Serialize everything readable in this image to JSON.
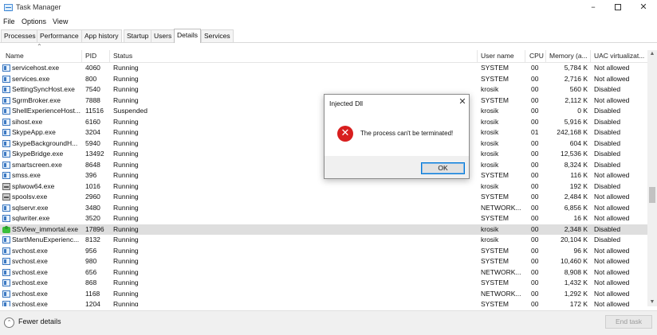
{
  "window": {
    "title": "Task Manager"
  },
  "menu": [
    "File",
    "Options",
    "View"
  ],
  "tabs": [
    {
      "label": "Processes",
      "active": false
    },
    {
      "label": "Performance",
      "active": false
    },
    {
      "label": "App history",
      "active": false
    },
    {
      "label": "Startup",
      "active": false
    },
    {
      "label": "Users",
      "active": false
    },
    {
      "label": "Details",
      "active": true
    },
    {
      "label": "Services",
      "active": false
    }
  ],
  "columns": {
    "name": "Name",
    "pid": "PID",
    "status": "Status",
    "user": "User name",
    "cpu": "CPU",
    "memory": "Memory (a...",
    "uac": "UAC virtualizat..."
  },
  "rows": [
    {
      "name": "servicehost.exe",
      "pid": "4060",
      "status": "Running",
      "user": "SYSTEM",
      "cpu": "00",
      "mem": "5,784 K",
      "uac": "Not allowed",
      "icon": "process-icon"
    },
    {
      "name": "services.exe",
      "pid": "800",
      "status": "Running",
      "user": "SYSTEM",
      "cpu": "00",
      "mem": "2,716 K",
      "uac": "Not allowed",
      "icon": "process-icon"
    },
    {
      "name": "SettingSyncHost.exe",
      "pid": "7540",
      "status": "Running",
      "user": "krosik",
      "cpu": "00",
      "mem": "560 K",
      "uac": "Disabled",
      "icon": "process-icon"
    },
    {
      "name": "SgrmBroker.exe",
      "pid": "7888",
      "status": "Running",
      "user": "SYSTEM",
      "cpu": "00",
      "mem": "2,112 K",
      "uac": "Not allowed",
      "icon": "process-icon"
    },
    {
      "name": "ShellExperienceHost....",
      "pid": "11516",
      "status": "Suspended",
      "user": "krosik",
      "cpu": "00",
      "mem": "0 K",
      "uac": "Disabled",
      "icon": "process-icon"
    },
    {
      "name": "sihost.exe",
      "pid": "6160",
      "status": "Running",
      "user": "krosik",
      "cpu": "00",
      "mem": "5,916 K",
      "uac": "Disabled",
      "icon": "process-icon"
    },
    {
      "name": "SkypeApp.exe",
      "pid": "3204",
      "status": "Running",
      "user": "krosik",
      "cpu": "01",
      "mem": "242,168 K",
      "uac": "Disabled",
      "icon": "process-icon"
    },
    {
      "name": "SkypeBackgroundH...",
      "pid": "5940",
      "status": "Running",
      "user": "krosik",
      "cpu": "00",
      "mem": "604 K",
      "uac": "Disabled",
      "icon": "process-icon"
    },
    {
      "name": "SkypeBridge.exe",
      "pid": "13492",
      "status": "Running",
      "user": "krosik",
      "cpu": "00",
      "mem": "12,536 K",
      "uac": "Disabled",
      "icon": "process-icon"
    },
    {
      "name": "smartscreen.exe",
      "pid": "8648",
      "status": "Running",
      "user": "krosik",
      "cpu": "00",
      "mem": "8,324 K",
      "uac": "Disabled",
      "icon": "process-icon"
    },
    {
      "name": "smss.exe",
      "pid": "396",
      "status": "Running",
      "user": "SYSTEM",
      "cpu": "00",
      "mem": "116 K",
      "uac": "Not allowed",
      "icon": "process-icon"
    },
    {
      "name": "splwow64.exe",
      "pid": "1016",
      "status": "Running",
      "user": "krosik",
      "cpu": "00",
      "mem": "192 K",
      "uac": "Disabled",
      "icon": "printer-icon"
    },
    {
      "name": "spoolsv.exe",
      "pid": "2960",
      "status": "Running",
      "user": "SYSTEM",
      "cpu": "00",
      "mem": "2,484 K",
      "uac": "Not allowed",
      "icon": "printer-icon"
    },
    {
      "name": "sqlservr.exe",
      "pid": "3480",
      "status": "Running",
      "user": "NETWORK...",
      "cpu": "00",
      "mem": "6,856 K",
      "uac": "Not allowed",
      "icon": "process-icon"
    },
    {
      "name": "sqlwriter.exe",
      "pid": "3520",
      "status": "Running",
      "user": "SYSTEM",
      "cpu": "00",
      "mem": "16 K",
      "uac": "Not allowed",
      "icon": "process-icon"
    },
    {
      "name": "SSView_immortal.exe",
      "pid": "17896",
      "status": "Running",
      "user": "krosik",
      "cpu": "00",
      "mem": "2,348 K",
      "uac": "Disabled",
      "icon": "puzzle-icon",
      "selected": true
    },
    {
      "name": "StartMenuExperienc...",
      "pid": "8132",
      "status": "Running",
      "user": "krosik",
      "cpu": "00",
      "mem": "20,104 K",
      "uac": "Disabled",
      "icon": "process-icon"
    },
    {
      "name": "svchost.exe",
      "pid": "956",
      "status": "Running",
      "user": "SYSTEM",
      "cpu": "00",
      "mem": "96 K",
      "uac": "Not allowed",
      "icon": "process-icon"
    },
    {
      "name": "svchost.exe",
      "pid": "980",
      "status": "Running",
      "user": "SYSTEM",
      "cpu": "00",
      "mem": "10,460 K",
      "uac": "Not allowed",
      "icon": "process-icon"
    },
    {
      "name": "svchost.exe",
      "pid": "656",
      "status": "Running",
      "user": "NETWORK...",
      "cpu": "00",
      "mem": "8,908 K",
      "uac": "Not allowed",
      "icon": "process-icon"
    },
    {
      "name": "svchost.exe",
      "pid": "868",
      "status": "Running",
      "user": "SYSTEM",
      "cpu": "00",
      "mem": "1,432 K",
      "uac": "Not allowed",
      "icon": "process-icon"
    },
    {
      "name": "svchost.exe",
      "pid": "1168",
      "status": "Running",
      "user": "NETWORK...",
      "cpu": "00",
      "mem": "1,292 K",
      "uac": "Not allowed",
      "icon": "process-icon"
    },
    {
      "name": "svchost.exe",
      "pid": "1204",
      "status": "Running",
      "user": "SYSTEM",
      "cpu": "00",
      "mem": "172 K",
      "uac": "Not allowed",
      "icon": "process-icon"
    }
  ],
  "footer": {
    "fewer_details": "Fewer details",
    "end_task": "End task"
  },
  "dialog": {
    "title": "Injected Dll",
    "message": "The process can't be terminated!",
    "ok_label": "OK",
    "icon": "error-icon"
  }
}
